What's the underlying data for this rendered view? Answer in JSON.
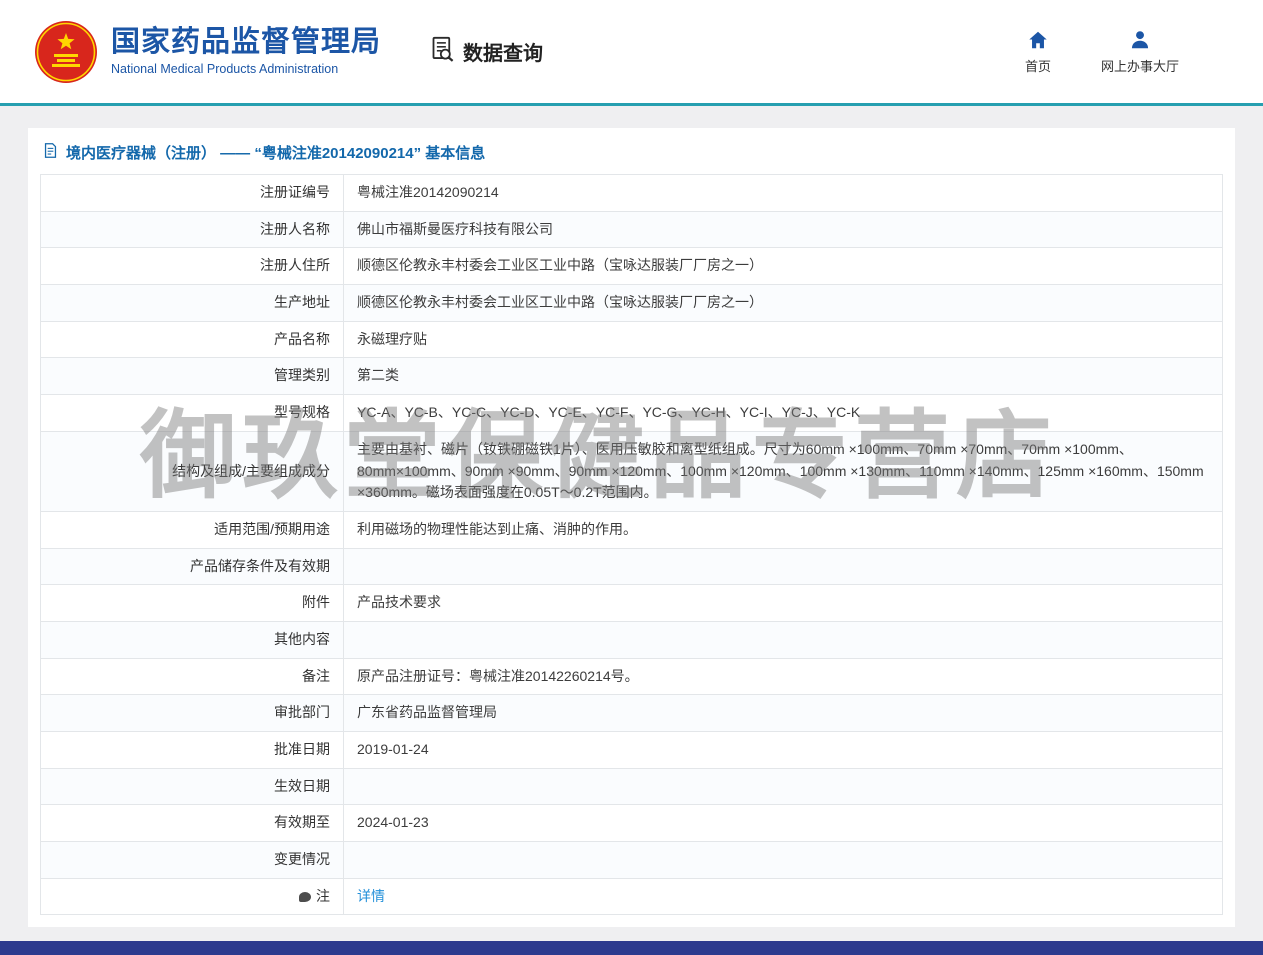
{
  "header": {
    "org_name_cn": "国家药品监督管理局",
    "org_name_en": "National Medical Products Administration",
    "data_query_label": "数据查询",
    "nav_home": "首页",
    "nav_hall": "网上办事大厅"
  },
  "page": {
    "title": "境内医疗器械（注册） —— “粤械注准20142090214” 基本信息",
    "watermark": "御玖堂保健品专营店"
  },
  "colors": {
    "brand_blue": "#1c56a6",
    "teal_line": "#269fb0",
    "footer_blue": "#2c3a8e",
    "title_blue": "#1368ab",
    "link_blue": "#2390d9",
    "emblem_red": "#d8261c",
    "emblem_gold": "#ffd700"
  },
  "table": {
    "rows": [
      {
        "label": "注册证编号",
        "value": "粤械注准20142090214"
      },
      {
        "label": "注册人名称",
        "value": "佛山市福斯曼医疗科技有限公司"
      },
      {
        "label": "注册人住所",
        "value": "顺德区伦教永丰村委会工业区工业中路（宝咏达服装厂厂房之一）"
      },
      {
        "label": "生产地址",
        "value": "顺德区伦教永丰村委会工业区工业中路（宝咏达服装厂厂房之一）"
      },
      {
        "label": "产品名称",
        "value": "永磁理疗贴"
      },
      {
        "label": "管理类别",
        "value": "第二类"
      },
      {
        "label": "型号规格",
        "value": "YC-A、YC-B、YC-C、YC-D、YC-E、YC-F、YC-G、YC-H、YC-I、YC-J、YC-K"
      },
      {
        "label": "结构及组成/主要组成成分",
        "value": "主要由基衬、磁片（钕铁硼磁铁1片）、医用压敏胶和离型纸组成。尺寸为60mm ×100mm、70mm ×70mm、70mm ×100mm、80mm×100mm、90mm ×90mm、90mm ×120mm、100mm ×120mm、100mm ×130mm、110mm ×140mm、125mm ×160mm、150mm ×360mm。磁场表面强度在0.05T～0.2T范围内。"
      },
      {
        "label": "适用范围/预期用途",
        "value": "利用磁场的物理性能达到止痛、消肿的作用。"
      },
      {
        "label": "产品储存条件及有效期",
        "value": ""
      },
      {
        "label": "附件",
        "value": "产品技术要求"
      },
      {
        "label": "其他内容",
        "value": ""
      },
      {
        "label": "备注",
        "value": "原产品注册证号：粤械注准20142260214号。"
      },
      {
        "label": "审批部门",
        "value": "广东省药品监督管理局"
      },
      {
        "label": "批准日期",
        "value": "2019-01-24"
      },
      {
        "label": "生效日期",
        "value": ""
      },
      {
        "label": "有效期至",
        "value": "2024-01-23"
      },
      {
        "label": "变更情况",
        "value": ""
      },
      {
        "label": "注",
        "value": "详情",
        "link": true,
        "icon": "note-icon"
      }
    ]
  }
}
